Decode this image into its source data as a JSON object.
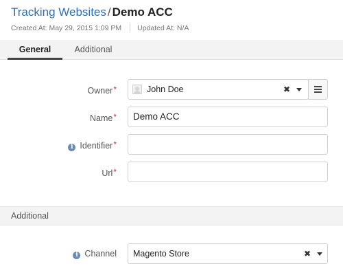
{
  "breadcrumb": {
    "parent": "Tracking Websites",
    "separator": "/",
    "current": "Demo ACC"
  },
  "meta": {
    "created": "Created At: May 29, 2015 1:09 PM",
    "updated": "Updated At: N/A"
  },
  "tabs": [
    {
      "label": "General",
      "active": true
    },
    {
      "label": "Additional",
      "active": false
    }
  ],
  "form": {
    "owner": {
      "label": "Owner",
      "required": "*",
      "value": "John Doe"
    },
    "name": {
      "label": "Name",
      "required": "*",
      "value": "Demo ACC"
    },
    "identifier": {
      "label": "Identifier",
      "required": "*",
      "value": ""
    },
    "url": {
      "label": "Url",
      "required": "*",
      "value": ""
    }
  },
  "section": {
    "title": "Additional",
    "channel": {
      "label": "Channel",
      "value": "Magento Store"
    }
  },
  "icons": {
    "info": "i",
    "clear": "✖"
  },
  "colors": {
    "link": "#2f6fb4",
    "required": "#c0392b",
    "info_icon": "#6b8cb5",
    "tab_underline": "#444444"
  }
}
